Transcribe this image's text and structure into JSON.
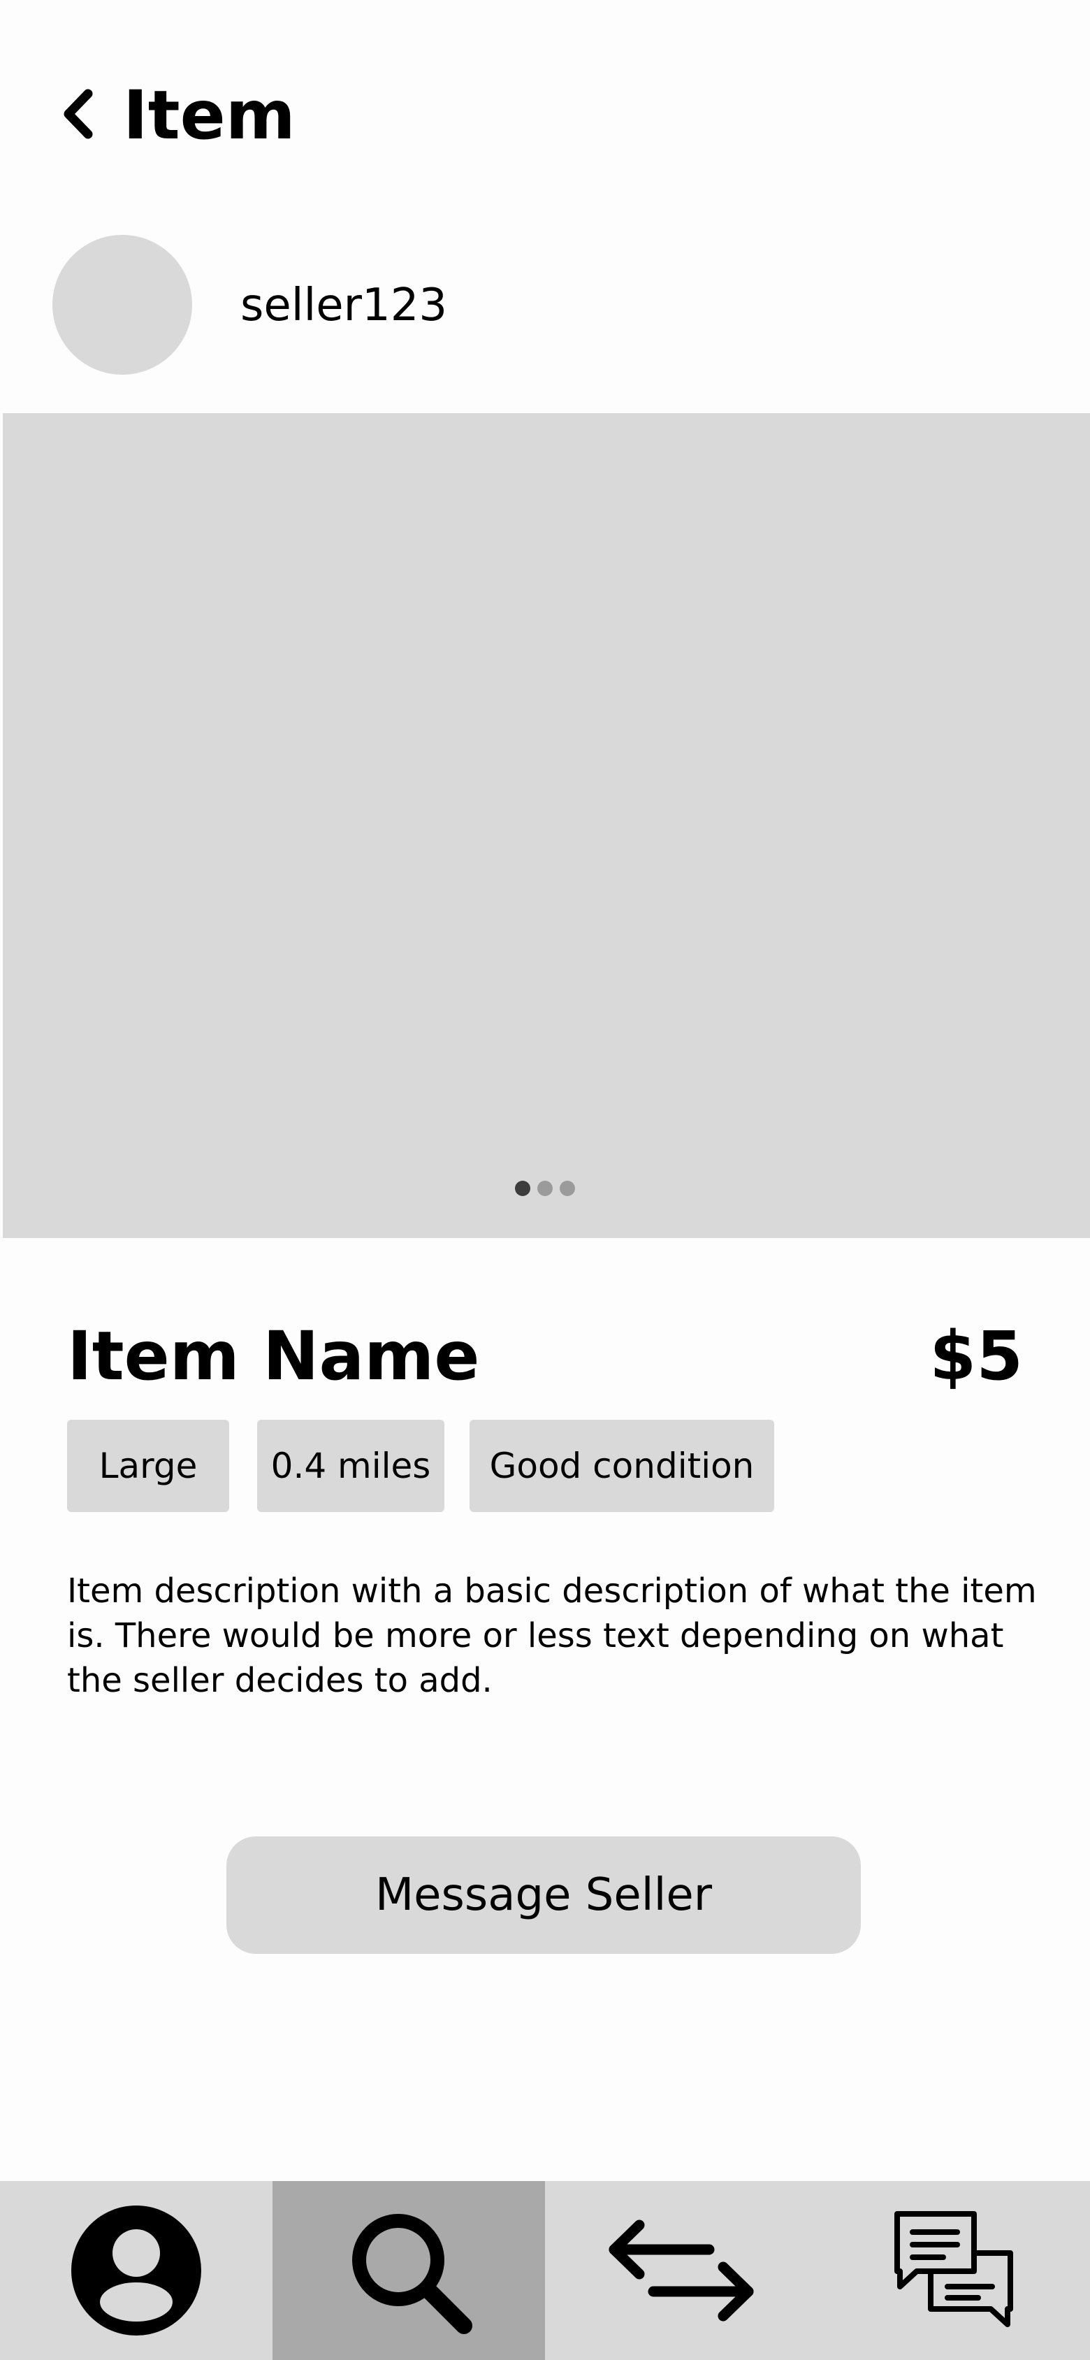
{
  "header": {
    "title": "Item",
    "back_icon": "chevron-left-icon"
  },
  "seller": {
    "username": "seller123"
  },
  "carousel": {
    "slide_count": 3,
    "active_index": 0
  },
  "item": {
    "name": "Item Name",
    "price": "$5",
    "tags": [
      "Large",
      "0.4 miles",
      "Good condition"
    ],
    "description": "Item description with a basic description of what the item is. There would be more or less text depending on what the seller decides to add."
  },
  "actions": {
    "message_label": "Message Seller"
  },
  "nav": {
    "items": [
      {
        "icon": "profile-icon",
        "active": false
      },
      {
        "icon": "search-icon",
        "active": true
      },
      {
        "icon": "swap-arrows-icon",
        "active": false
      },
      {
        "icon": "chat-bubbles-icon",
        "active": false
      }
    ]
  },
  "colors": {
    "placeholder": "#d9d9d9",
    "nav_active": "#a9a9a9",
    "dot_active": "#3d3d3d",
    "dot_inactive": "#9b9b9b"
  }
}
